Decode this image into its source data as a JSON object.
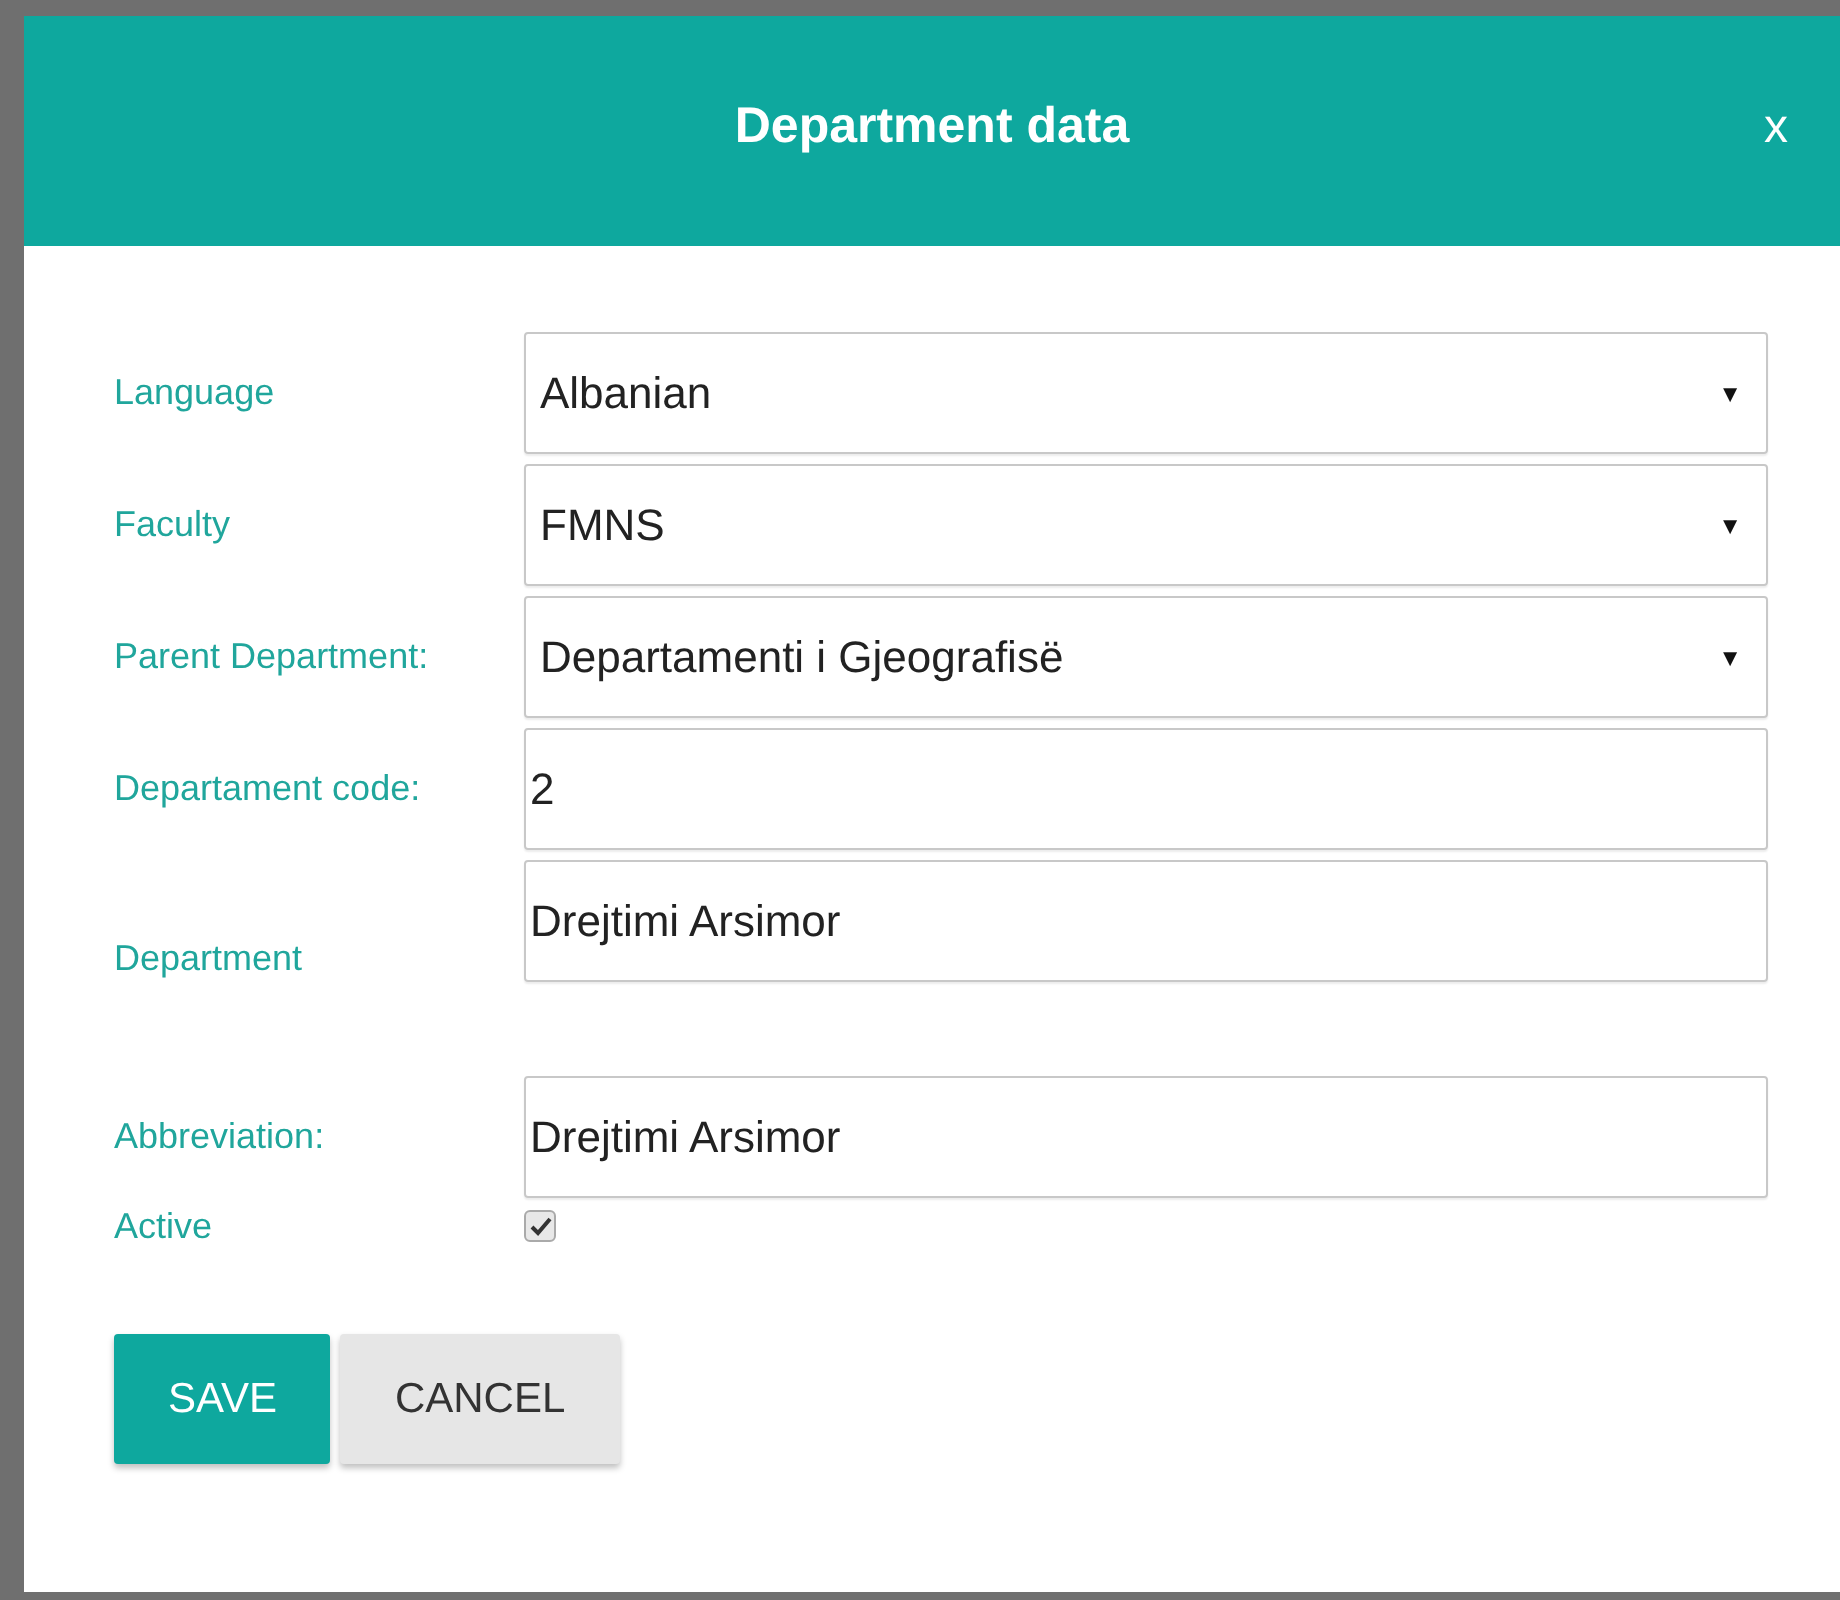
{
  "dialog": {
    "title": "Department data",
    "close": "x"
  },
  "fields": [
    {
      "label": "Language",
      "kind": "select",
      "value": "Albanian",
      "caret": "▼"
    },
    {
      "label": "Faculty",
      "kind": "select",
      "value": "FMNS",
      "caret": "▼"
    },
    {
      "label": "Parent Department:",
      "kind": "select",
      "value": "Departamenti i Gjeografisë",
      "caret": "▼"
    },
    {
      "label": "Departament code:",
      "kind": "text",
      "value": "2"
    },
    {
      "label": "Department",
      "kind": "text",
      "value": "Drejtimi Arsimor",
      "tall": true
    },
    {
      "label": "Abbreviation:",
      "kind": "text",
      "value": "Drejtimi Arsimor"
    },
    {
      "label": "Active",
      "kind": "checkbox",
      "checked": true
    }
  ],
  "buttons": [
    {
      "label": "SAVE",
      "kind": "primary"
    },
    {
      "label": "CANCEL",
      "kind": "secondary"
    }
  ]
}
